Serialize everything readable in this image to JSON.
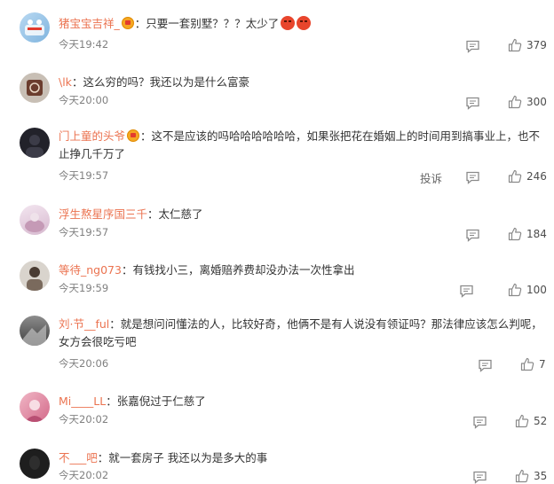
{
  "comments": [
    {
      "user": "猪宝宝吉祥_",
      "text": "：只要一套别墅？？？太少了",
      "time": "今天19:42",
      "likes": "379"
    },
    {
      "user": "\\lk",
      "text": "：这么穷的吗？我还以为是什么富豪",
      "time": "今天20:00",
      "likes": "300"
    },
    {
      "user": "门上童的头爷",
      "text": "：这不是应该的吗哈哈哈哈哈哈，如果张把花在婚姻上的时间用到搞事业上，也不止挣几千万了",
      "time": "今天19:57",
      "likes": "246",
      "report": "投诉"
    },
    {
      "user": "浮生熬星序国三千",
      "text": "：太仁慈了",
      "time": "今天19:57",
      "likes": "184"
    },
    {
      "user": "等待_ng073",
      "text": "：有钱找小三，离婚赔养费却没办法一次性拿出",
      "time": "今天19:59",
      "likes": "100"
    },
    {
      "user": "刘·节__ful",
      "text": "：就是想问问懂法的人，比较好奇，他俩不是有人说没有领证吗？那法律应该怎么判呢，女方会很吃亏吧",
      "time": "今天20:06",
      "likes": "7"
    },
    {
      "user": "Mi____LL",
      "text": "：张嘉倪过于仁慈了",
      "time": "今天20:02",
      "likes": "52"
    },
    {
      "user": "不___吧",
      "text": "：就一套房子 我还以为是多大的事",
      "time": "今天20:02",
      "likes": "35"
    }
  ],
  "colors": {
    "username": "#eb7350",
    "text": "#333333",
    "time": "#808080",
    "icon": "#8a8a8a"
  },
  "icons": {
    "reply": "comment-bubble-icon",
    "like": "thumbs-up-icon",
    "badge": "vip-badge-icon",
    "emoji": "angry-face-icon"
  }
}
